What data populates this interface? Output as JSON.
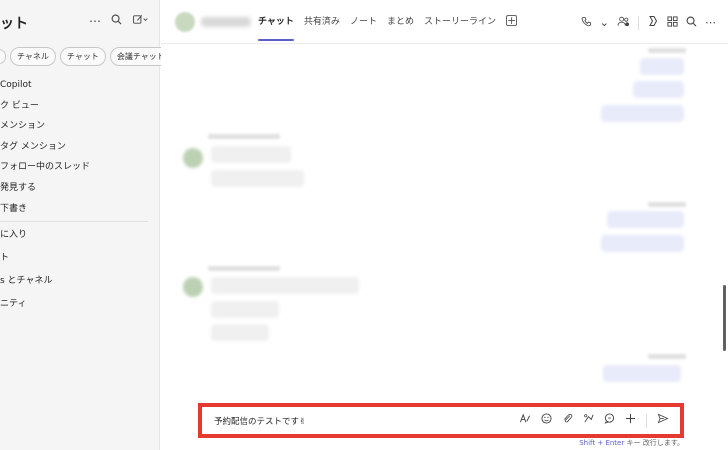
{
  "sidebar": {
    "title": "ット",
    "header_icons": [
      "more-icon",
      "search-icon",
      "compose-icon"
    ],
    "filters": [
      "",
      "チャネル",
      "チャット",
      "会議チャット"
    ],
    "items": [
      "Copilot",
      "ク ビュー",
      "メンション",
      "タグ メンション",
      "フォロー中のスレッド",
      "発見する",
      "下書き"
    ],
    "items2": [
      "に入り",
      "ト",
      "s とチャネル",
      "ニティ"
    ]
  },
  "topbar": {
    "tabs": [
      "チャット",
      "共有済み",
      "ノート",
      "まとめ",
      "ストーリーライン"
    ],
    "active_tab": "チャット",
    "icons": [
      "call-icon",
      "chevron-down-icon",
      "people-icon",
      "copilot-icon",
      "apps-icon",
      "search-icon",
      "more-icon"
    ]
  },
  "compose": {
    "text": "予約配信のテストです✌",
    "tools": [
      "format-icon",
      "emoji-icon",
      "attach-icon",
      "loop-icon",
      "chat-icon",
      "add-icon",
      "send-icon"
    ],
    "hint_key": "Shift + Enter",
    "hint_rest": "キー 改行します。"
  },
  "colors": {
    "accent": "#5b5fc7",
    "highlight": "#e43a2f",
    "bubble_mine": "#e8ebfa",
    "bubble_other": "#f0f0f0"
  }
}
